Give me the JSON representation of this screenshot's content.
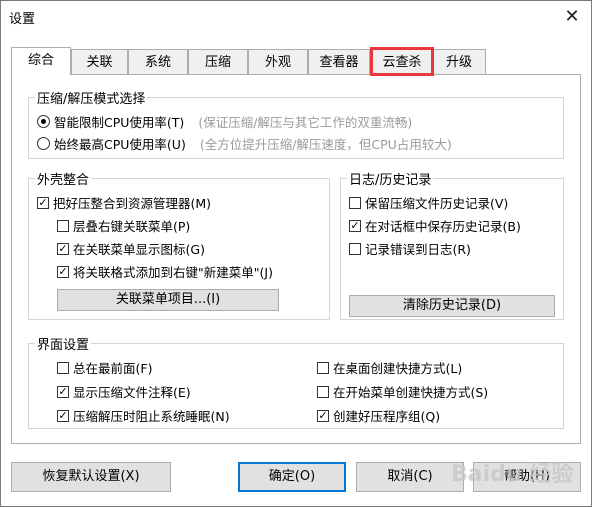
{
  "window": {
    "title": "设置",
    "close_label": "✕"
  },
  "tabs": [
    {
      "label": "综合"
    },
    {
      "label": "关联"
    },
    {
      "label": "系统"
    },
    {
      "label": "压缩"
    },
    {
      "label": "外观"
    },
    {
      "label": "查看器"
    },
    {
      "label": "云查杀"
    },
    {
      "label": "升级"
    }
  ],
  "mode_group": {
    "title": "压缩/解压模式选择",
    "options": [
      {
        "label": "智能限制CPU使用率(T)",
        "hint": "(保证压缩/解压与其它工作的双重流畅)",
        "selected": true
      },
      {
        "label": "始终最高CPU使用率(U)",
        "hint": "(全方位提升压缩/解压速度，但CPU占用较大)",
        "selected": false
      }
    ]
  },
  "shell_group": {
    "title": "外壳整合",
    "main": {
      "label": "把好压整合到资源管理器(M)",
      "checked": true
    },
    "items": [
      {
        "label": "层叠右键关联菜单(P)",
        "checked": false
      },
      {
        "label": "在关联菜单显示图标(G)",
        "checked": true
      },
      {
        "label": "将关联格式添加到右键\"新建菜单\"(J)",
        "checked": true
      }
    ],
    "button_label": "关联菜单项目...(I)"
  },
  "history_group": {
    "title": "日志/历史记录",
    "items": [
      {
        "label": "保留压缩文件历史记录(V)",
        "checked": false
      },
      {
        "label": "在对话框中保存历史记录(B)",
        "checked": true
      },
      {
        "label": "记录错误到日志(R)",
        "checked": false
      }
    ],
    "button_label": "清除历史记录(D)"
  },
  "ui_group": {
    "title": "界面设置",
    "left": [
      {
        "label": "总在最前面(F)",
        "checked": false
      },
      {
        "label": "显示压缩文件注释(E)",
        "checked": true
      },
      {
        "label": "压缩解压时阻止系统睡眠(N)",
        "checked": true
      }
    ],
    "right": [
      {
        "label": "在桌面创建快捷方式(L)",
        "checked": false
      },
      {
        "label": "在开始菜单创建快捷方式(S)",
        "checked": false
      },
      {
        "label": "创建好压程序组(Q)",
        "checked": true
      }
    ]
  },
  "footer": {
    "restore_label": "恢复默认设置(X)",
    "ok_label": "确定(O)",
    "cancel_label": "取消(C)",
    "help_label": "帮助(H)"
  },
  "watermark": "Baidu 经验",
  "colors": {
    "highlight": "#e8383d",
    "focus": "#0078d7"
  }
}
